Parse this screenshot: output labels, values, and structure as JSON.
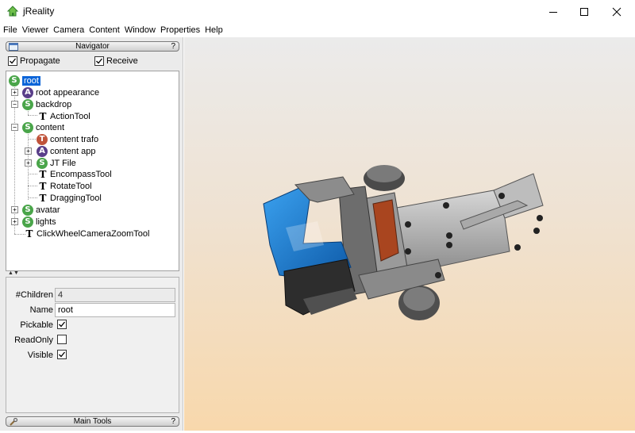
{
  "window": {
    "title": "jReality"
  },
  "menu": [
    "File",
    "Viewer",
    "Camera",
    "Content",
    "Window",
    "Properties",
    "Help"
  ],
  "navigator": {
    "title": "Navigator",
    "help": "?",
    "propagate": {
      "label": "Propagate",
      "checked": true
    },
    "receive": {
      "label": "Receive",
      "checked": true
    }
  },
  "tree": {
    "nodes": [
      {
        "label": "root",
        "badge": "S",
        "selected": true
      },
      {
        "label": "root appearance",
        "badge": "A"
      },
      {
        "label": "backdrop",
        "badge": "S"
      },
      {
        "label": "ActionTool",
        "badge": "T"
      },
      {
        "label": "content",
        "badge": "S"
      },
      {
        "label": "content trafo",
        "badge": "T"
      },
      {
        "label": "content app",
        "badge": "A"
      },
      {
        "label": "JT File",
        "badge": "S"
      },
      {
        "label": "EncompassTool",
        "badge": "T"
      },
      {
        "label": "RotateTool",
        "badge": "T"
      },
      {
        "label": "DraggingTool",
        "badge": "T"
      },
      {
        "label": "avatar",
        "badge": "S"
      },
      {
        "label": "lights",
        "badge": "S"
      },
      {
        "label": "ClickWheelCameraZoomTool",
        "badge": "T"
      }
    ]
  },
  "properties": {
    "children": {
      "label": "#Children",
      "value": "4"
    },
    "name": {
      "label": "Name",
      "value": "root"
    },
    "pickable": {
      "label": "Pickable",
      "checked": true
    },
    "readonly": {
      "label": "ReadOnly",
      "checked": false
    },
    "visible": {
      "label": "Visible",
      "checked": true
    }
  },
  "main_tools": {
    "title": "Main Tools",
    "help": "?"
  },
  "colors": {
    "selection": "#0a64d8",
    "scene": "#4aa54a",
    "appearance": "#5a3f8a",
    "transform": "#c0543b",
    "part_blue": "#1e7fd0"
  }
}
